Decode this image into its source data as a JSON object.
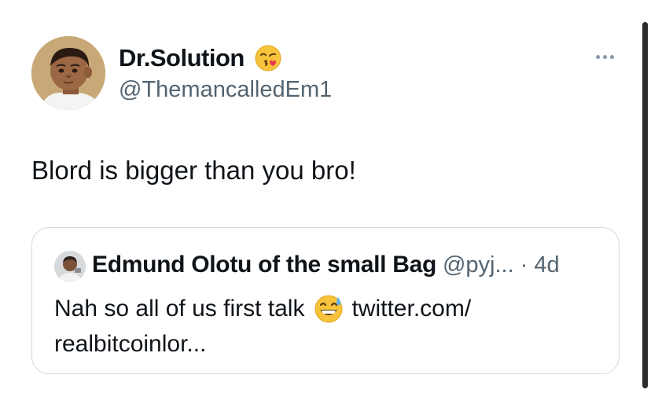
{
  "author": {
    "display_name": "Dr.Solution",
    "name_emoji": "face-blowing-a-kiss",
    "handle": "@ThemancalledEm1"
  },
  "tweet": {
    "text": "Blord is bigger than you bro!"
  },
  "quoted_tweet": {
    "author_name": "Edmund Olotu of the small Bag",
    "author_handle": "@pyj...",
    "separator": "·",
    "time": "4d",
    "text_part1": "Nah so all of us first talk",
    "text_emoji": "grinning-face-with-sweat",
    "text_part2": "twitter.com/",
    "text_line2": "realbitcoinlor..."
  },
  "colors": {
    "text_primary": "#0f1419",
    "text_secondary": "#536471",
    "border": "#cfd9de",
    "background": "#ffffff"
  }
}
